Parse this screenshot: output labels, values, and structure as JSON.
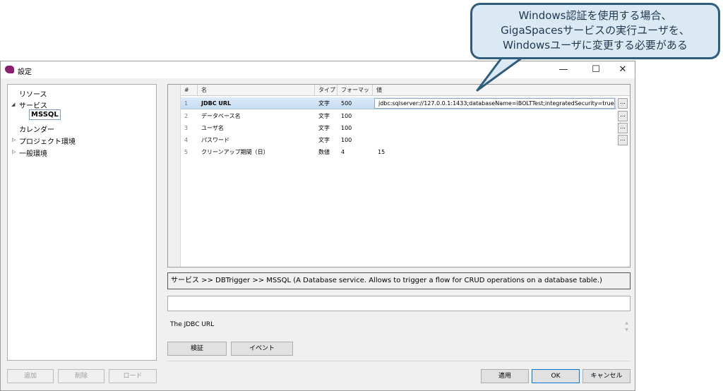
{
  "callout": {
    "line1": "Windows認証を使用する場合、",
    "line2": "GigaSpacesサービスの実行ユーザを、",
    "line3": "Windowsユーザに変更する必要がある"
  },
  "window": {
    "title": "設定",
    "minimize": "—",
    "maximize": "☐",
    "close": "✕"
  },
  "tree": {
    "resource": "リソース",
    "service": "サービス",
    "mssql": "MSSQL",
    "calendar": "カレンダー",
    "project_env": "プロジェクト環境",
    "general_env": "一般環境"
  },
  "left_buttons": {
    "add": "追加",
    "delete": "削除",
    "load": "ロード"
  },
  "grid": {
    "columns": {
      "num": "#",
      "name": "名",
      "type": "タイプ",
      "format": "フォーマット",
      "value": "値"
    },
    "rows": [
      {
        "num": "1",
        "name": "JDBC URL",
        "type": "文字",
        "format": "500",
        "value": "jdbc:sqlserver://127.0.0.1:1433;databaseName=iBOLTTest;integratedSecurity=true"
      },
      {
        "num": "2",
        "name": "データベース名",
        "type": "文字",
        "format": "100",
        "value": ""
      },
      {
        "num": "3",
        "name": "ユーザ名",
        "type": "文字",
        "format": "100",
        "value": ""
      },
      {
        "num": "4",
        "name": "パスワード",
        "type": "文字",
        "format": "100",
        "value": ""
      },
      {
        "num": "5",
        "name": "クリーンアップ期間（日）",
        "type": "数値",
        "format": "4",
        "value": "15"
      }
    ],
    "ellipsis": "..."
  },
  "breadcrumb": "サービス >> DBTrigger >> MSSQL (A Database service. Allows to trigger a flow for CRUD operations on a database table.)",
  "description": "The JDBC URL",
  "buttons": {
    "verify": "検証",
    "event": "イベント",
    "apply": "適用",
    "ok": "OK",
    "cancel": "キャンセル"
  }
}
